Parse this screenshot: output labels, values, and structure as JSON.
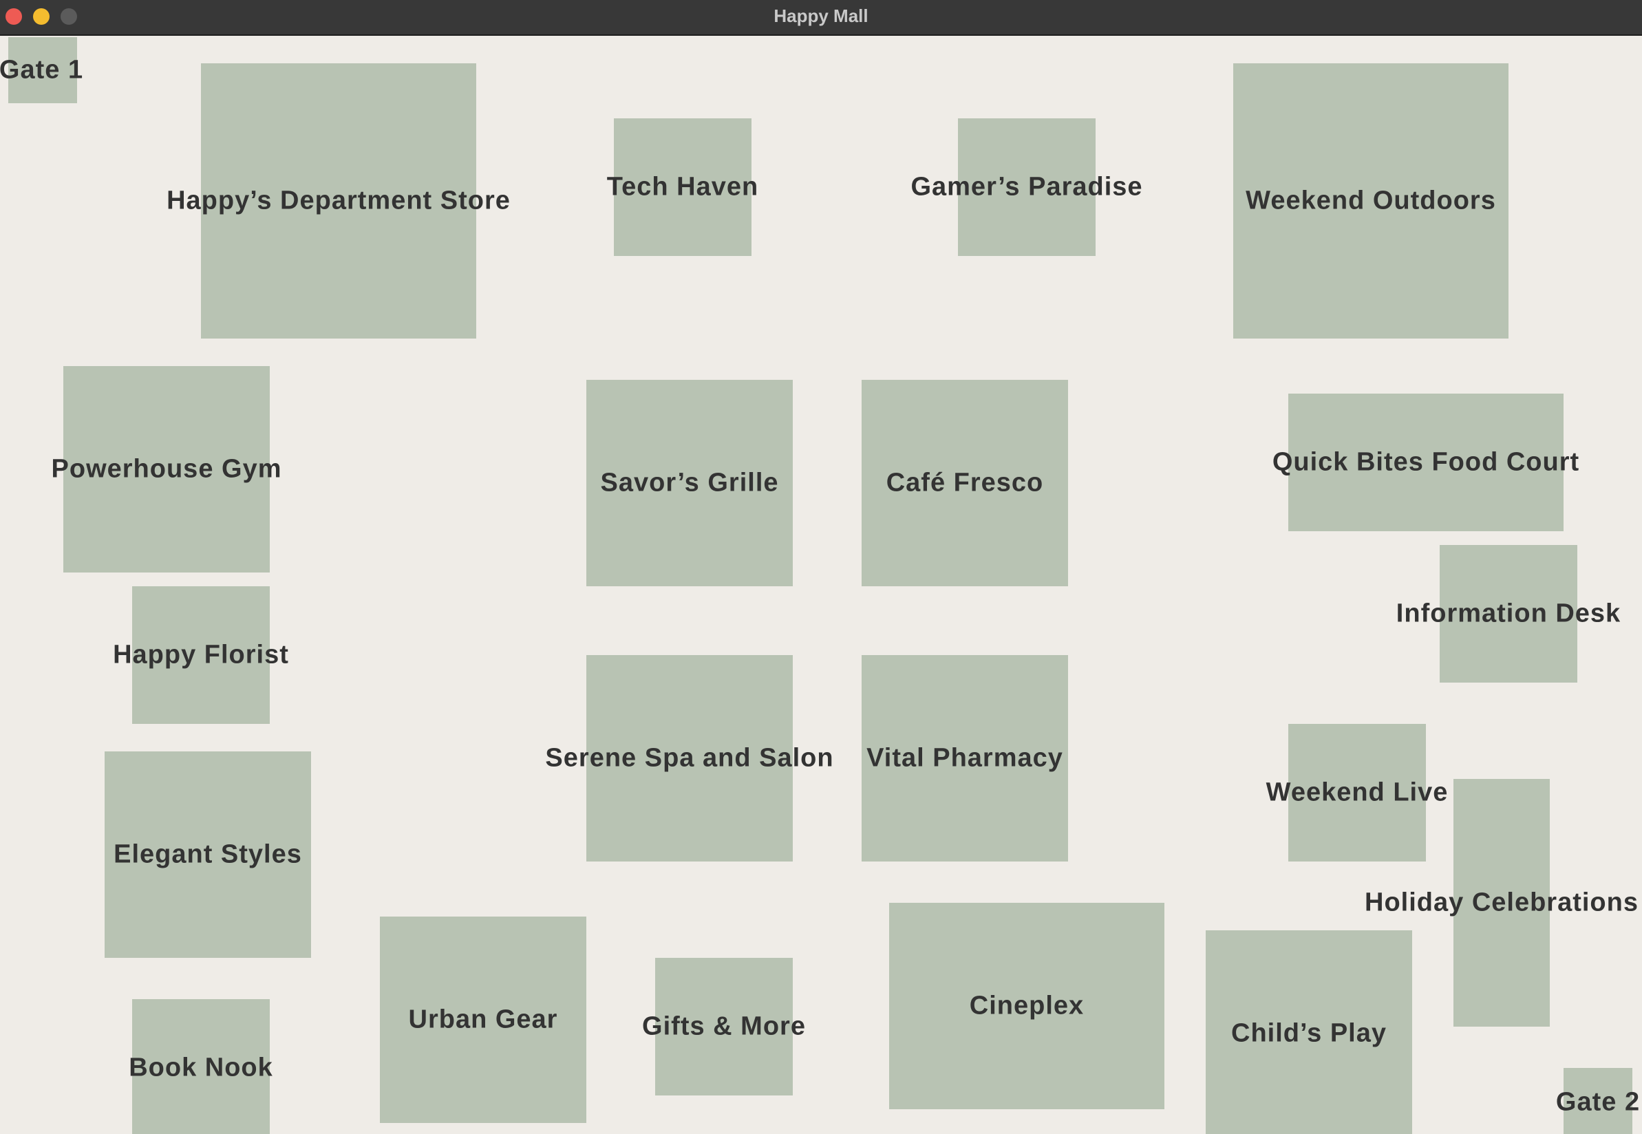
{
  "window": {
    "title": "Happy Mall",
    "controls": [
      "close",
      "minimize",
      "zoom"
    ]
  },
  "colors": {
    "background": "#efece7",
    "store_fill": "#b8c3b3",
    "label_text": "#333333",
    "titlebar": "#383838"
  },
  "map": {
    "stores": [
      {
        "id": "gate-1",
        "name": "Gate 1"
      },
      {
        "id": "happys-department-store",
        "name": "Happy’s Department Store"
      },
      {
        "id": "tech-haven",
        "name": "Tech Haven"
      },
      {
        "id": "gamers-paradise",
        "name": "Gamer’s Paradise"
      },
      {
        "id": "weekend-outdoors",
        "name": "Weekend Outdoors"
      },
      {
        "id": "powerhouse-gym",
        "name": "Powerhouse Gym"
      },
      {
        "id": "savors-grille",
        "name": "Savor’s Grille"
      },
      {
        "id": "cafe-fresco",
        "name": "Café Fresco"
      },
      {
        "id": "quick-bites-food-court",
        "name": "Quick Bites Food Court"
      },
      {
        "id": "information-desk",
        "name": "Information Desk"
      },
      {
        "id": "happy-florist",
        "name": "Happy Florist"
      },
      {
        "id": "serene-spa-and-salon",
        "name": "Serene Spa and Salon"
      },
      {
        "id": "vital-pharmacy",
        "name": "Vital Pharmacy"
      },
      {
        "id": "weekend-live",
        "name": "Weekend Live"
      },
      {
        "id": "holiday-celebrations",
        "name": "Holiday Celebrations"
      },
      {
        "id": "elegant-styles",
        "name": "Elegant Styles"
      },
      {
        "id": "urban-gear",
        "name": "Urban Gear"
      },
      {
        "id": "gifts-and-more",
        "name": "Gifts & More"
      },
      {
        "id": "cineplex",
        "name": "Cineplex"
      },
      {
        "id": "childs-play",
        "name": "Child’s Play"
      },
      {
        "id": "book-nook",
        "name": "Book Nook"
      },
      {
        "id": "gate-2",
        "name": "Gate 2"
      }
    ]
  }
}
